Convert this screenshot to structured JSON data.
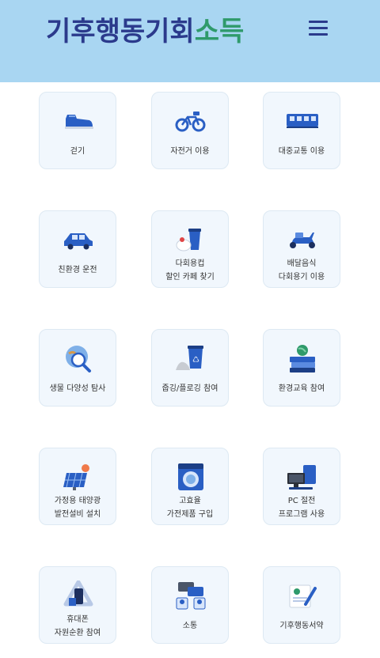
{
  "header": {
    "logo_part1": "기후",
    "logo_part2": "행동",
    "logo_part3": "기회",
    "logo_part4": "소득",
    "menu_icon": "hamburger-menu-icon",
    "background_color": "#a9d6f2",
    "brand_color": "#2b3a8c",
    "accent_color": "#2f9a6b"
  },
  "activities": [
    {
      "label": "걷기",
      "icon": "shoe-icon"
    },
    {
      "label": "자전거 이용",
      "icon": "bicycle-icon"
    },
    {
      "label": "대중교통 이용",
      "icon": "bus-icon"
    },
    {
      "label": "친환경 운전",
      "icon": "car-icon"
    },
    {
      "label": "다회용컵\n할인 카페 찾기",
      "icon": "cup-icon"
    },
    {
      "label": "배달음식\n다회용기 이용",
      "icon": "scooter-icon"
    },
    {
      "label": "생물 다양성 탐사",
      "icon": "magnifier-globe-icon"
    },
    {
      "label": "줍깅/플로깅 참여",
      "icon": "recycle-bin-icon"
    },
    {
      "label": "환경교육 참여",
      "icon": "books-globe-icon"
    },
    {
      "label": "가정용 태양광\n발전설비 설치",
      "icon": "solar-panel-icon"
    },
    {
      "label": "고효율\n가전제품 구입",
      "icon": "washing-machine-icon"
    },
    {
      "label": "PC 절전\n프로그램 사용",
      "icon": "computer-icon"
    },
    {
      "label": "휴대폰\n자원순환 참여",
      "icon": "phone-recycle-icon"
    },
    {
      "label": "소통",
      "icon": "chat-people-icon"
    },
    {
      "label": "기후행동서약",
      "icon": "pledge-document-icon"
    }
  ]
}
